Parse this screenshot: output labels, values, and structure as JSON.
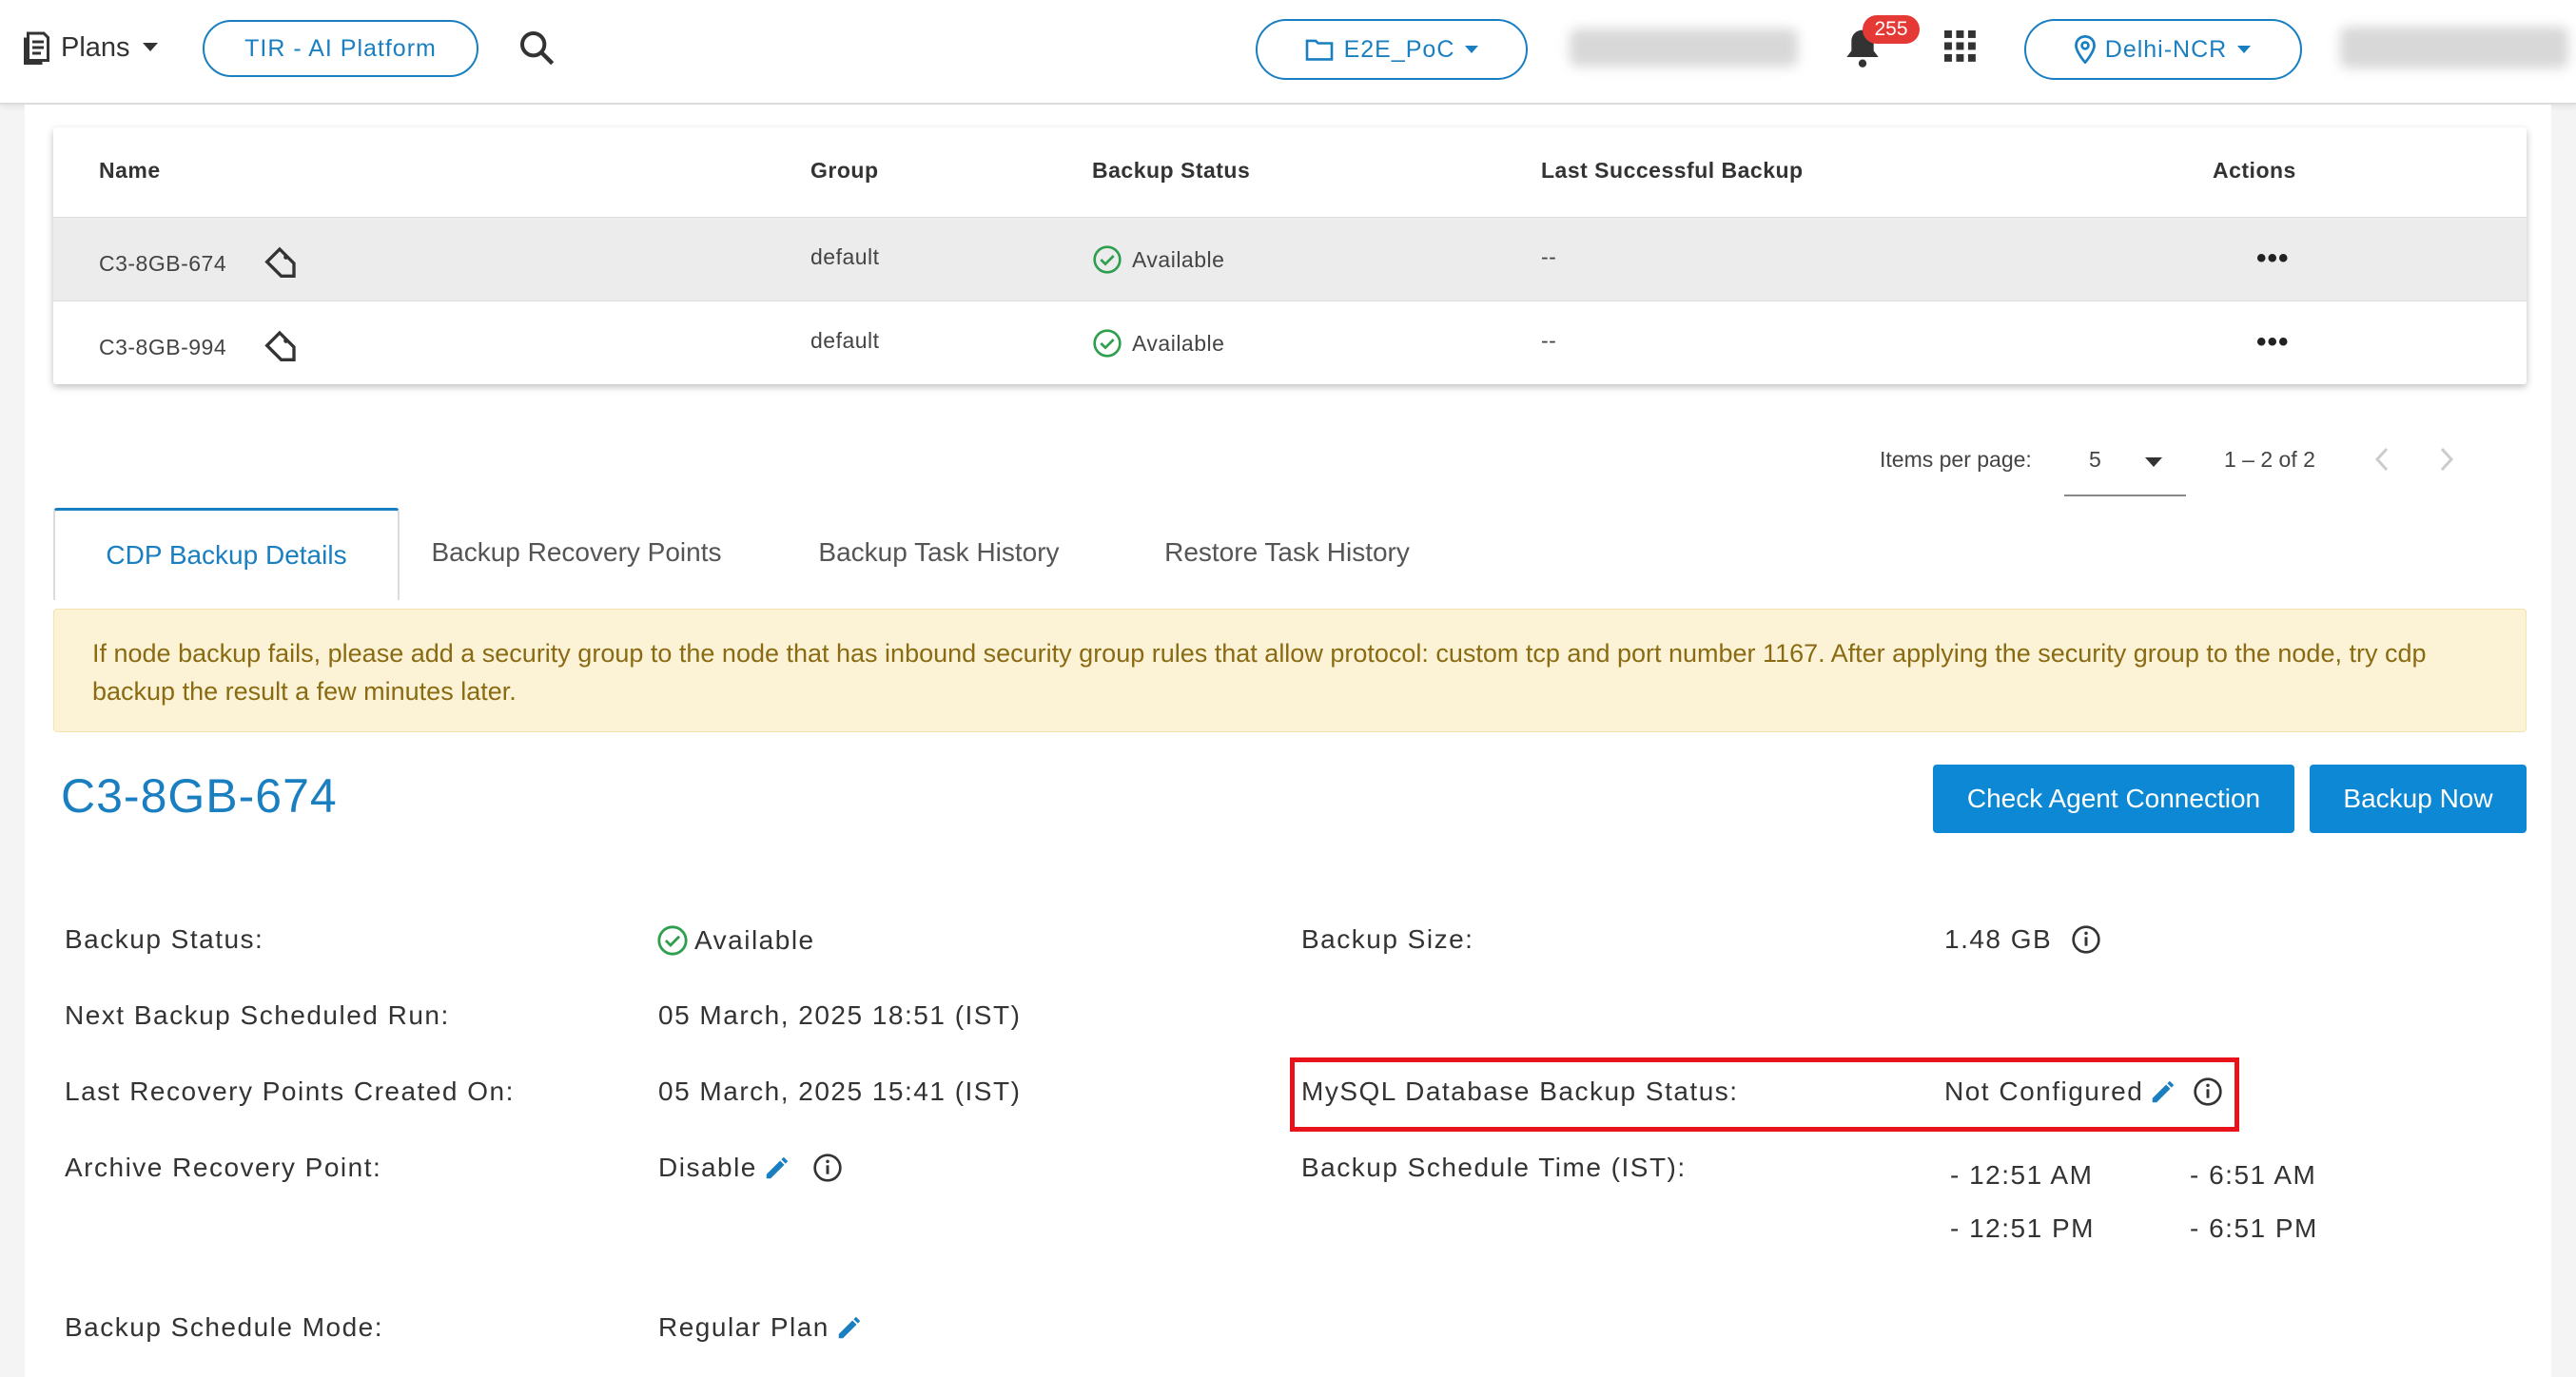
{
  "topbar": {
    "plans_label": "Plans",
    "platform_label": "TIR - AI Platform",
    "project_label": "E2E_PoC",
    "notification_count": "255",
    "region_label": "Delhi-NCR"
  },
  "table": {
    "headers": {
      "name": "Name",
      "group": "Group",
      "status": "Backup Status",
      "last": "Last Successful Backup",
      "actions": "Actions"
    },
    "rows": [
      {
        "name": "C3-8GB-674",
        "group": "default",
        "status": "Available",
        "last": "--"
      },
      {
        "name": "C3-8GB-994",
        "group": "default",
        "status": "Available",
        "last": "--"
      }
    ]
  },
  "pagination": {
    "items_per_page_label": "Items per page:",
    "items_per_page_value": "5",
    "range": "1 – 2 of 2"
  },
  "tabs": [
    "CDP Backup Details",
    "Backup Recovery Points",
    "Backup Task History",
    "Restore Task History"
  ],
  "warning": "If node backup fails, please add a security group to the node that has inbound security group rules that allow protocol: custom tcp and port number 1167. After applying the security group to the node, try cdp backup the result a few minutes later.",
  "details": {
    "node_name": "C3-8GB-674",
    "check_agent_button": "Check Agent Connection",
    "backup_now_button": "Backup Now",
    "backup_status_label": "Backup Status:",
    "backup_status_value": "Available",
    "next_run_label": "Next Backup Scheduled Run:",
    "next_run_value": "05 March, 2025 18:51 (IST)",
    "last_rp_label": "Last Recovery Points Created On:",
    "last_rp_value": "05 March, 2025 15:41 (IST)",
    "archive_label": "Archive Recovery Point:",
    "archive_value": "Disable",
    "schedule_mode_label": "Backup Schedule Mode:",
    "schedule_mode_value": "Regular Plan",
    "backup_size_label": "Backup Size:",
    "backup_size_value": "1.48 GB",
    "mysql_label": "MySQL Database Backup Status:",
    "mysql_value": "Not Configured",
    "schedule_time_label": "Backup Schedule Time (IST):",
    "schedule_times": [
      "- 12:51 AM",
      "- 6:51 AM",
      "- 12:51 PM",
      "- 6:51 PM"
    ]
  },
  "colors": {
    "accent": "#1a7fc1",
    "button": "#0d88d4",
    "success": "#2e9e4f",
    "badge": "#e53935",
    "highlight": "#e8121a",
    "warning_bg": "#fcf3d6"
  }
}
